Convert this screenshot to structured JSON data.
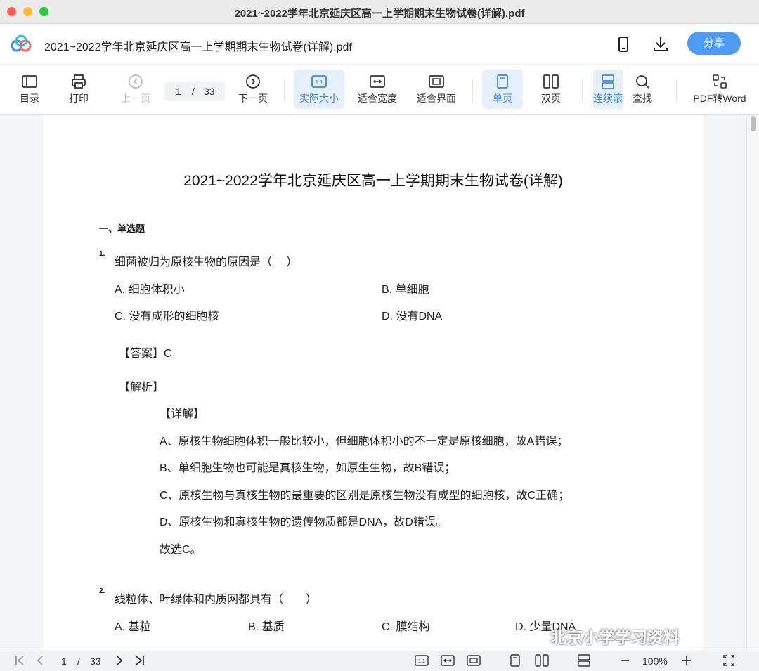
{
  "window": {
    "title": "2021~2022学年北京延庆区高一上学期期末生物试卷(详解).pdf"
  },
  "header": {
    "doc_title": "2021~2022学年北京延庆区高一上学期期末生物试卷(详解).pdf",
    "icons": [
      "mobile-icon",
      "download-icon"
    ],
    "share_label": "分享",
    "accent": "#4e9bf5"
  },
  "toolbar": {
    "toc": "目录",
    "print": "打印",
    "prev": "上一页",
    "page_current": "1",
    "page_sep": "/",
    "page_total": "33",
    "next": "下一页",
    "actual_size": "实际大小",
    "fit_width": "适合宽度",
    "fit_page": "适合界面",
    "single_page": "单页",
    "double_page": "双页",
    "continuous": "连续滚",
    "find": "查找",
    "pdf_to_word": "PDF转Word"
  },
  "document": {
    "heading": "2021~2022学年北京延庆区高一上学期期末生物试卷(详解)",
    "section": "一、单选题",
    "q1": {
      "num": "1.",
      "text": "细菌被归为原核生物的原因是（　 ）",
      "options": [
        "A. 细胞体积小",
        "B. 单细胞",
        "C. 没有成形的细胞核",
        "D. 没有DNA"
      ],
      "answer": "【答案】C",
      "analysis": "【解析】",
      "detail": "【详解】",
      "lines": [
        "A、原核生物细胞体积一般比较小，但细胞体积小的不一定是原核细胞，故A错误；",
        "B、单细胞生物也可能是真核生物，如原生生物，故B错误；",
        "C、原核生物与真核生物的最重要的区别是原核生物没有成型的细胞核，故C正确；",
        "D、原核生物和真核生物的遗传物质都是DNA，故D错误。",
        "故选C。"
      ]
    },
    "q2": {
      "num": "2.",
      "text": "线粒体、叶绿体和内质网都具有（　　）",
      "options": [
        "A. 基粒",
        "B. 基质",
        "C. 膜结构",
        "D. 少量DNA"
      ]
    }
  },
  "bottombar": {
    "page_current": "1",
    "page_sep": "/",
    "page_total": "33",
    "zoom": "100%"
  },
  "watermark": "北京小学学习资料"
}
